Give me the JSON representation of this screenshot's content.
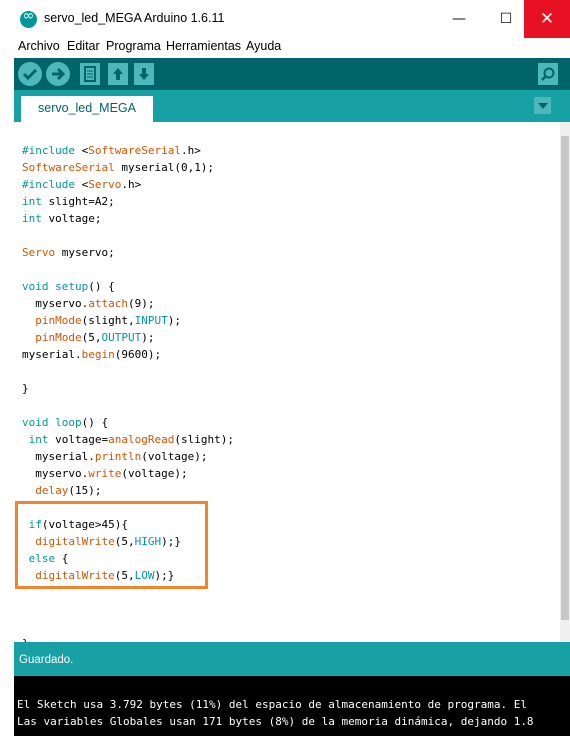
{
  "window": {
    "title": "servo_led_MEGA Arduino 1.6.11",
    "min_glyph": "—",
    "max_glyph": "☐",
    "close_glyph": "✕"
  },
  "menu": [
    "Archivo",
    "Editar",
    "Programa",
    "Herramientas",
    "Ayuda"
  ],
  "toolbar": {
    "buttons": [
      "verify-icon",
      "upload-icon",
      "new-icon",
      "open-icon",
      "save-icon",
      "serial-monitor-icon"
    ]
  },
  "tabs": [
    {
      "label": "servo_led_MEGA",
      "active": true
    }
  ],
  "code_lines": [
    [
      [
        "kw",
        "#include "
      ],
      [
        "",
        "<"
      ],
      [
        "fn",
        "SoftwareSerial"
      ],
      [
        "",
        ".h>"
      ]
    ],
    [
      [
        "fn",
        "SoftwareSerial"
      ],
      [
        "",
        " myserial(0,1);"
      ]
    ],
    [
      [
        "kw",
        "#include "
      ],
      [
        "",
        "<"
      ],
      [
        "fn",
        "Servo"
      ],
      [
        "",
        ".h>"
      ]
    ],
    [
      [
        "kw",
        "int"
      ],
      [
        "",
        " slight=A2;"
      ]
    ],
    [
      [
        "kw",
        "int"
      ],
      [
        "",
        " voltage;"
      ]
    ],
    [],
    [
      [
        "fn",
        "Servo"
      ],
      [
        "",
        " myservo;"
      ]
    ],
    [],
    [
      [
        "kw",
        "void"
      ],
      [
        "",
        " "
      ],
      [
        "kw",
        "setup"
      ],
      [
        "",
        "() {"
      ]
    ],
    [
      [
        "",
        "  myservo."
      ],
      [
        "fn",
        "attach"
      ],
      [
        "",
        "(9);"
      ]
    ],
    [
      [
        "",
        "  "
      ],
      [
        "fn",
        "pinMode"
      ],
      [
        "",
        "(slight,"
      ],
      [
        "cst",
        "INPUT"
      ],
      [
        "",
        ");"
      ]
    ],
    [
      [
        "",
        "  "
      ],
      [
        "fn",
        "pinMode"
      ],
      [
        "",
        "(5,"
      ],
      [
        "cst",
        "OUTPUT"
      ],
      [
        "",
        ");"
      ]
    ],
    [
      [
        "",
        "myserial."
      ],
      [
        "fn",
        "begin"
      ],
      [
        "",
        "(9600);"
      ]
    ],
    [],
    [
      [
        "",
        "}"
      ]
    ],
    [],
    [
      [
        "kw",
        "void"
      ],
      [
        "",
        " "
      ],
      [
        "kw",
        "loop"
      ],
      [
        "",
        "() {"
      ]
    ],
    [
      [
        "",
        ""
      ],
      [
        "kw",
        " int"
      ],
      [
        "",
        " voltage="
      ],
      [
        "fn",
        "analogRead"
      ],
      [
        "",
        "(slight);"
      ]
    ],
    [
      [
        "",
        "  myserial."
      ],
      [
        "fn",
        "println"
      ],
      [
        "",
        "(voltage);"
      ]
    ],
    [
      [
        "",
        "  myservo."
      ],
      [
        "fn",
        "write"
      ],
      [
        "",
        "(voltage);"
      ]
    ],
    [
      [
        "",
        "  "
      ],
      [
        "fn",
        "delay"
      ],
      [
        "",
        "(15);"
      ]
    ],
    [],
    [
      [
        "",
        ""
      ],
      [
        "kw",
        " if"
      ],
      [
        "",
        "(voltage>45){"
      ]
    ],
    [
      [
        "",
        "  "
      ],
      [
        "fn",
        "digitalWrite"
      ],
      [
        "",
        "(5,"
      ],
      [
        "cst",
        "HIGH"
      ],
      [
        "",
        ");}"
      ]
    ],
    [
      [
        "",
        ""
      ],
      [
        "kw",
        " else"
      ],
      [
        "",
        " {"
      ]
    ],
    [
      [
        "",
        "  "
      ],
      [
        "fn",
        "digitalWrite"
      ],
      [
        "",
        "(5,"
      ],
      [
        "cst",
        "LOW"
      ],
      [
        "",
        ");}"
      ]
    ],
    [],
    [],
    [],
    [
      [
        "",
        "}"
      ]
    ]
  ],
  "status": {
    "text": "Guardado."
  },
  "console": {
    "lines": [
      "El Sketch usa 3.792 bytes (11%) del espacio de almacenamiento de programa. El",
      "Las variables Globales usan 171 bytes (8%) de la memoria dinámica, dejando 1.8"
    ]
  },
  "colors": {
    "toolbar": "#006468",
    "tabbar": "#17a1a5",
    "keyword": "#00979c",
    "function": "#d35400",
    "highlight": "#f0852c"
  }
}
